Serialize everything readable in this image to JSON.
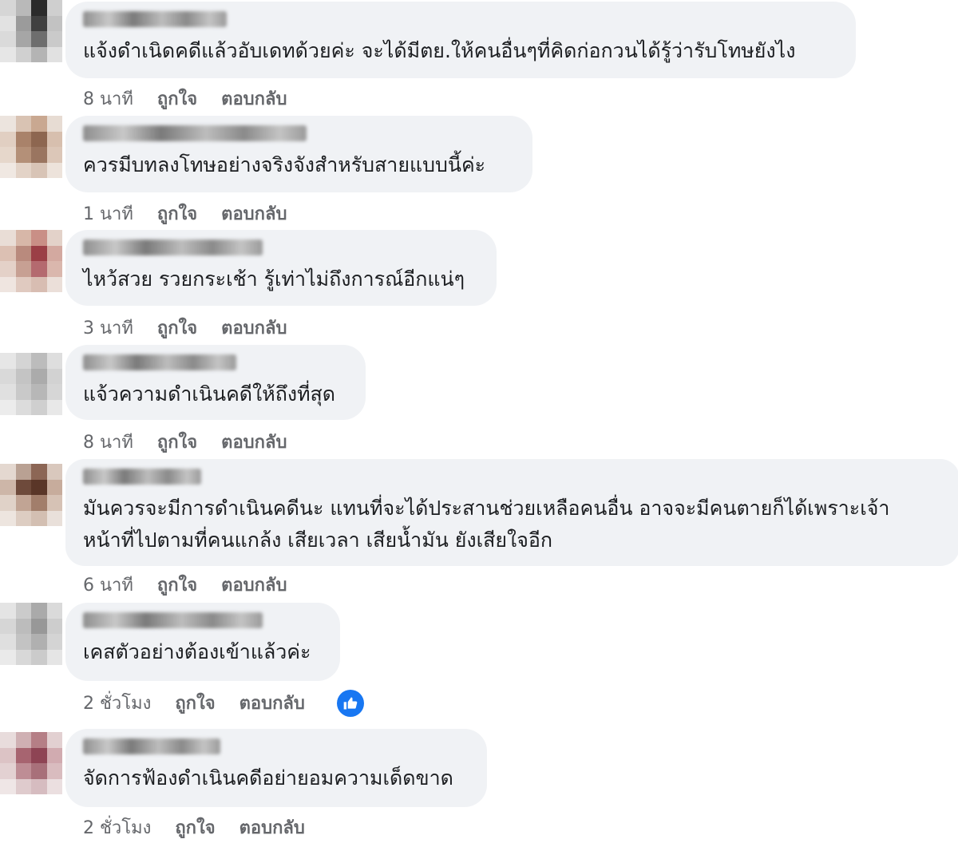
{
  "comments": [
    {
      "text": "แจ้งดำเนิดคดีแล้วอับเดทด้วยค่ะ จะได้มีตย.ให้คนอื่นๆที่คิดก่อกวนได้รู้ว่ารับโทษยังไง",
      "time": "8 นาที",
      "like_label": "ถูกใจ",
      "reply_label": "ตอบกลับ",
      "avatar_colors": [
        "#d6d6d6",
        "#b9b9b9",
        "#2b2b2b",
        "#cfcfcf",
        "#e2e2e2",
        "#9b9b9b",
        "#404040",
        "#c2c2c2",
        "#dadada",
        "#a6a6a6",
        "#6e6e6e",
        "#cacaca",
        "#e6e6e6",
        "#d0d0d0",
        "#b4b4b4",
        "#e1e1e1"
      ]
    },
    {
      "text": "ควรมีบทลงโทษอย่างจริงจังสำหรับสายแบบนี้ค่ะ",
      "time": "1 นาที",
      "like_label": "ถูกใจ",
      "reply_label": "ตอบกลับ",
      "avatar_colors": [
        "#ece4de",
        "#d9c3b3",
        "#c9a891",
        "#e7dcd3",
        "#e1cfc2",
        "#a9826a",
        "#8d6650",
        "#d7bfae",
        "#e6d7cb",
        "#b49078",
        "#9a7560",
        "#dcc7b8",
        "#f0e8e2",
        "#e3d3c7",
        "#d8c4b6",
        "#ede3db"
      ]
    },
    {
      "text": "ไหว้สวย รวยกระเช้า รู้เท่าไม่ถึงการณ์อีกแน่ๆ",
      "time": "3 นาที",
      "like_label": "ถูกใจ",
      "reply_label": "ตอบกลับ",
      "avatar_colors": [
        "#e9ddd6",
        "#d7b7a8",
        "#c98f86",
        "#e3d2c9",
        "#dcc0b3",
        "#b98a7d",
        "#9b3f46",
        "#d3a9a0",
        "#e4d1c8",
        "#c7a093",
        "#b46a6f",
        "#dab7ad",
        "#efe5e0",
        "#e0cac0",
        "#d8bdb2",
        "#ebdfd9"
      ]
    },
    {
      "text": "แจ้วความดำเนินคดีให้ถึงที่สุด",
      "time": "8 นาที",
      "like_label": "ถูกใจ",
      "reply_label": "ตอบกลับ",
      "avatar_colors": [
        "#e6e6e6",
        "#d4d4d4",
        "#bcbcbc",
        "#dedede",
        "#d9d9d9",
        "#c4c4c4",
        "#ababab",
        "#d2d2d2",
        "#e0e0e0",
        "#c9c9c9",
        "#b7b7b7",
        "#d6d6d6",
        "#ececec",
        "#dcdcdc",
        "#cfcfcf",
        "#e8e8e8"
      ]
    },
    {
      "text": "มันควรจะมีการดำเนินคดีนะ แทนที่จะได้ประสานช่วยเหลือคนอื่น อาจจะมีคนตายก็ได้เพราะเจ้าหน้าที่ไปตามที่คนแกล้ง เสียเวลา เสียน้ำมัน ยังเสียใจอีก",
      "time": "6 นาที",
      "like_label": "ถูกใจ",
      "reply_label": "ตอบกลับ",
      "avatar_colors": [
        "#e4d8d0",
        "#b9a193",
        "#8c6655",
        "#d9c8bd",
        "#cdb6a8",
        "#6e4a3b",
        "#5a3628",
        "#c7ac9c",
        "#e0d2c8",
        "#c1a494",
        "#a27e6b",
        "#d6c2b5",
        "#ede5df",
        "#ddcdc2",
        "#d3bfb2",
        "#e9e0da"
      ]
    },
    {
      "text": "เคสตัวอย่างต้องเข้าแล้วค่ะ",
      "time": "2 ชั่วโมง",
      "like_label": "ถูกใจ",
      "reply_label": "ตอบกลับ",
      "avatar_colors": [
        "#e4e4e4",
        "#cbcbcb",
        "#aaaaaa",
        "#dadada",
        "#d6d6d6",
        "#bcbcbc",
        "#989898",
        "#cdcdcd",
        "#dfdfdf",
        "#c3c3c3",
        "#b0b0b0",
        "#d4d4d4",
        "#eaeaea",
        "#d8d8d8",
        "#cbcbcb",
        "#e5e5e5"
      ],
      "reaction_icon": "thumbs-up-icon"
    },
    {
      "text": "จัดการฟ้องดำเนินคดีอย่ายอมความเด็ดขาด",
      "time": "2 ชั่วโมง",
      "like_label": "ถูกใจ",
      "reply_label": "ตอบกลับ",
      "avatar_colors": [
        "#e8dcdc",
        "#cfb0b3",
        "#b57f86",
        "#e2d0d1",
        "#dcc3c5",
        "#a76470",
        "#8e4454",
        "#d1abb0",
        "#e3d1d2",
        "#be8d95",
        "#a8707a",
        "#d9bcbf",
        "#efe6e6",
        "#dfcbcd",
        "#d6bcc0",
        "#ebdfe0"
      ]
    }
  ],
  "accent_color": "#1877f2"
}
